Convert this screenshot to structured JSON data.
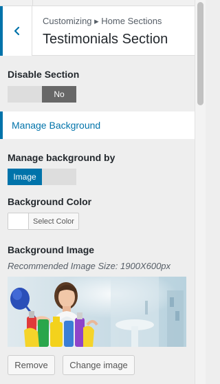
{
  "header": {
    "breadcrumb": "Customizing ▸ Home Sections",
    "title": "Testimonials Section"
  },
  "disable_section": {
    "label": "Disable Section",
    "toggle_off_label": "",
    "toggle_on_label": "No",
    "state": "No"
  },
  "manage_background_section": {
    "label": "Manage Background"
  },
  "manage_background_by": {
    "label": "Manage background by",
    "option_selected": "Image",
    "option_other": ""
  },
  "background_color": {
    "label": "Background Color",
    "button_label": "Select Color",
    "current_color": "#ffffff"
  },
  "background_image": {
    "label": "Background Image",
    "hint": "Recommended Image Size: 1900X600px"
  },
  "actions": {
    "remove_label": "Remove",
    "change_label": "Change image"
  },
  "colors": {
    "accent": "#0073aa",
    "toggle_on_dark": "#676767"
  }
}
